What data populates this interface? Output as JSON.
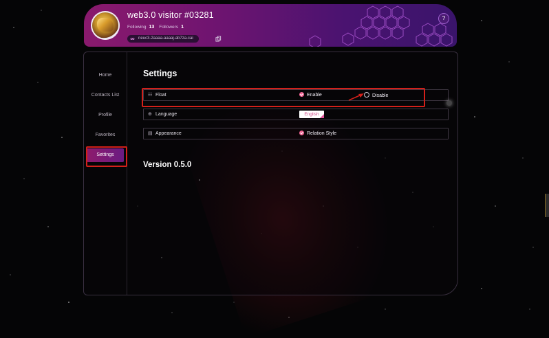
{
  "header": {
    "username": "web3.0 visitor #03281",
    "following_label": "Following",
    "following_count": "13",
    "followers_label": "Followers",
    "followers_count": "1",
    "principal_id": "neuc3-2aaaa-aaaaj-ab7za-cai",
    "help_label": "?"
  },
  "sidebar": {
    "items": [
      {
        "label": "Home"
      },
      {
        "label": "Contacts List"
      },
      {
        "label": "Profile"
      },
      {
        "label": "Favorites"
      },
      {
        "label": "Settings"
      }
    ]
  },
  "settings": {
    "title": "Settings",
    "rows": [
      {
        "label": "Float",
        "icon": "float-icon",
        "option1": "Enable",
        "option2": "Disable"
      },
      {
        "label": "Language",
        "icon": "globe-icon",
        "value": "English"
      },
      {
        "label": "Appearance",
        "icon": "appearance-icon",
        "option1": "Relation Style"
      }
    ],
    "version": "Version 0.5.0"
  },
  "colors": {
    "accent": "#8d1b6c",
    "radio_checked": "#f06292",
    "annotation": "#d4201a"
  }
}
